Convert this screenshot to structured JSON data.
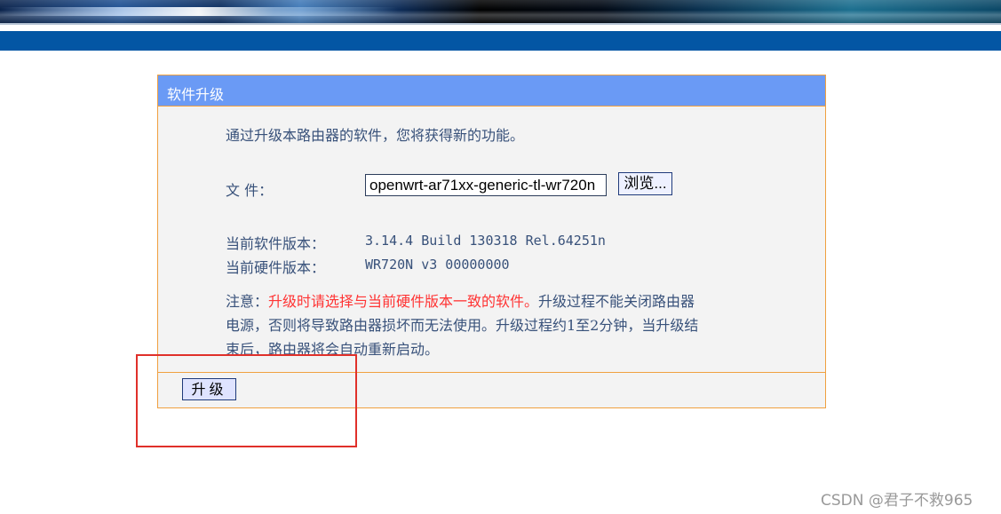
{
  "panel": {
    "title": "软件升级",
    "intro": "通过升级本路由器的软件，您将获得新的功能。",
    "file_label": "文 件：",
    "file_value": "openwrt-ar71xx-generic-tl-wr720n",
    "browse_label": "浏览...",
    "current_software_label": "当前软件版本：",
    "current_software_value": "3.14.4 Build 130318 Rel.64251n",
    "current_hardware_label": "当前硬件版本：",
    "current_hardware_value": "WR720N v3 00000000",
    "notice_prefix": "注意：",
    "notice_red": "升级时请选择与当前硬件版本一致的软件。",
    "notice_rest_line1": "升级过程不能关闭路由器",
    "notice_line2": "电源，否则将导致路由器损坏而无法使用。升级过程约1至2分钟，当升级结",
    "notice_line3": "束后，路由器将会自动重新启动。",
    "upgrade_label": "升级"
  },
  "watermark": "CSDN @君子不救965",
  "colors": {
    "header_blue": "#6a9af5",
    "topbar_blue": "#0356a4",
    "panel_border": "#f0a040",
    "text_blue": "#38517a",
    "warning_red": "#ff3333",
    "highlight_red": "#e0302a"
  }
}
